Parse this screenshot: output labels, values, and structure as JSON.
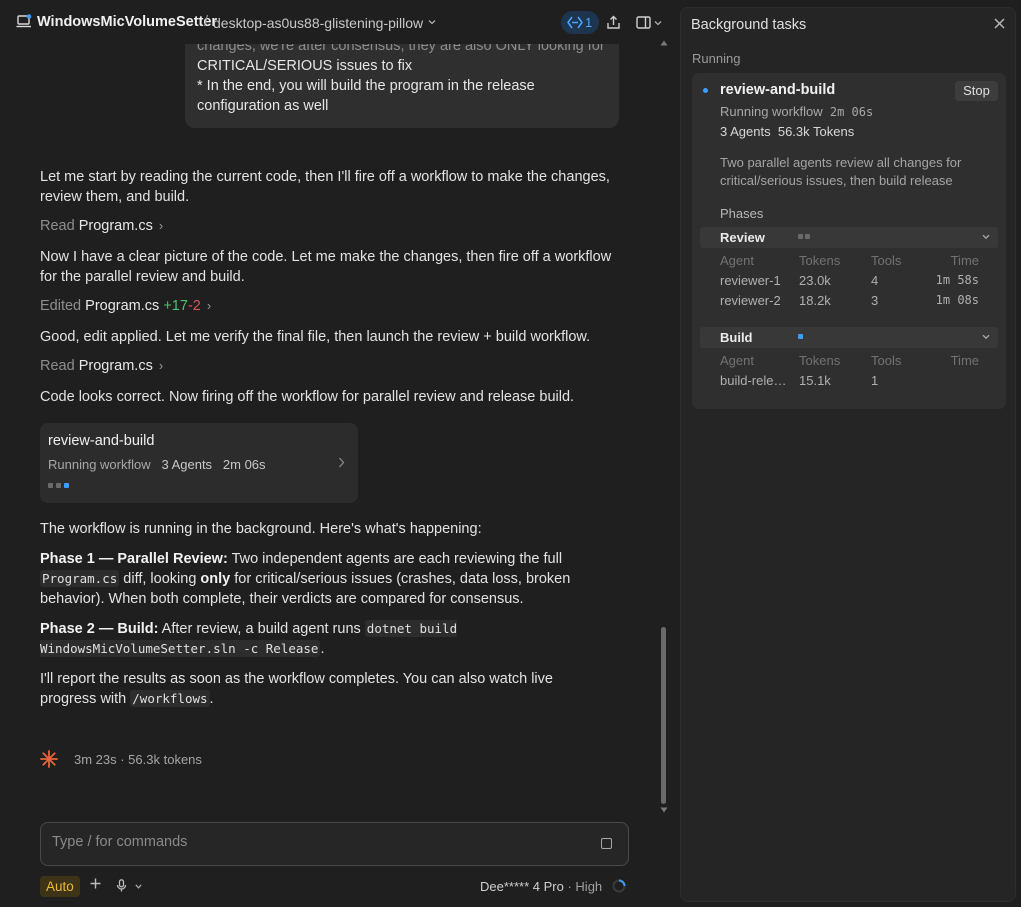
{
  "header": {
    "project": "WindowsMicVolumeSetter",
    "separator": "/",
    "branch": "desktop-as0us88-glistening-pillow",
    "workflow_badge_count": "1"
  },
  "chat": {
    "user_bubble_lines": [
      "changes, we're after consensus, they are also ONLY looking for",
      "CRITICAL/SERIOUS issues to fix",
      "* In the end, you will build the program in the release",
      "configuration as well"
    ],
    "msg1": "Let me start by reading the current code, then I'll fire off a workflow to make the changes, review them, and build.",
    "tool1": {
      "verb": "Read",
      "file": "Program.cs",
      "chev": "›"
    },
    "msg2": "Now I have a clear picture of the code. Let me make the changes, then fire off a workflow for the parallel review and build.",
    "tool2": {
      "verb": "Edited",
      "file": "Program.cs",
      "added": "+17",
      "removed": "-2",
      "chev": "›"
    },
    "msg3": "Good, edit applied. Let me verify the final file, then launch the review + build workflow.",
    "tool3": {
      "verb": "Read",
      "file": "Program.cs",
      "chev": "›"
    },
    "msg4": "Code looks correct. Now firing off the workflow for parallel review and release build.",
    "workflow_card": {
      "title": "review-and-build",
      "status": "Running workflow",
      "agents": "3 Agents",
      "elapsed": "2m 06s"
    },
    "msg5": "The workflow is running in the background. Here's what's happening:",
    "phase1": {
      "label": "Phase 1 — Parallel Review:",
      "text_a": " Two independent agents are each reviewing the full ",
      "code": "Program.cs",
      "text_b": " diff, looking ",
      "bold": "only",
      "text_c": " for critical/serious issues (crashes, data loss, broken behavior). When both complete, their verdicts are compared for consensus."
    },
    "phase2": {
      "label": "Phase 2 — Build:",
      "text_a": " After review, a build agent runs ",
      "code": "dotnet build WindowsMicVolumeSetter.sln -c Release",
      "text_b": "."
    },
    "msg6": {
      "text_a": "I'll report the results as soon as the workflow completes. You can also watch live progress with ",
      "code": "/workflows",
      "text_b": "."
    },
    "stats": "3m 23s · 56.3k tokens"
  },
  "composer": {
    "placeholder": "Type / for commands",
    "mode": "Auto",
    "model": "Dee***** 4 Pro",
    "separator": "·",
    "effort": "High"
  },
  "panel": {
    "title": "Background tasks",
    "section": "Running",
    "task": {
      "name": "review-and-build",
      "stop_label": "Stop",
      "status": "Running workflow",
      "elapsed": "2m 06s",
      "agents": "3 Agents",
      "tokens": "56.3k Tokens",
      "description": "Two parallel agents review all changes for critical/serious issues, then build release",
      "phases_label": "Phases",
      "columns": [
        "Agent",
        "Tokens",
        "Tools",
        "Time"
      ],
      "phases": [
        {
          "name": "Review",
          "rows": [
            {
              "agent": "reviewer-1",
              "tokens": "23.0k",
              "tools": "4",
              "time": "1m 58s"
            },
            {
              "agent": "reviewer-2",
              "tokens": "18.2k",
              "tools": "3",
              "time": "1m 08s"
            }
          ]
        },
        {
          "name": "Build",
          "rows": [
            {
              "agent": "build-rele…",
              "tokens": "15.1k",
              "tools": "1",
              "time": ""
            }
          ]
        }
      ]
    }
  },
  "colors": {
    "accent_blue": "#3b9dff",
    "added": "#4cc26b",
    "removed": "#e3505a",
    "auto_badge": "#e8b93a",
    "spark": "#e8643a"
  }
}
